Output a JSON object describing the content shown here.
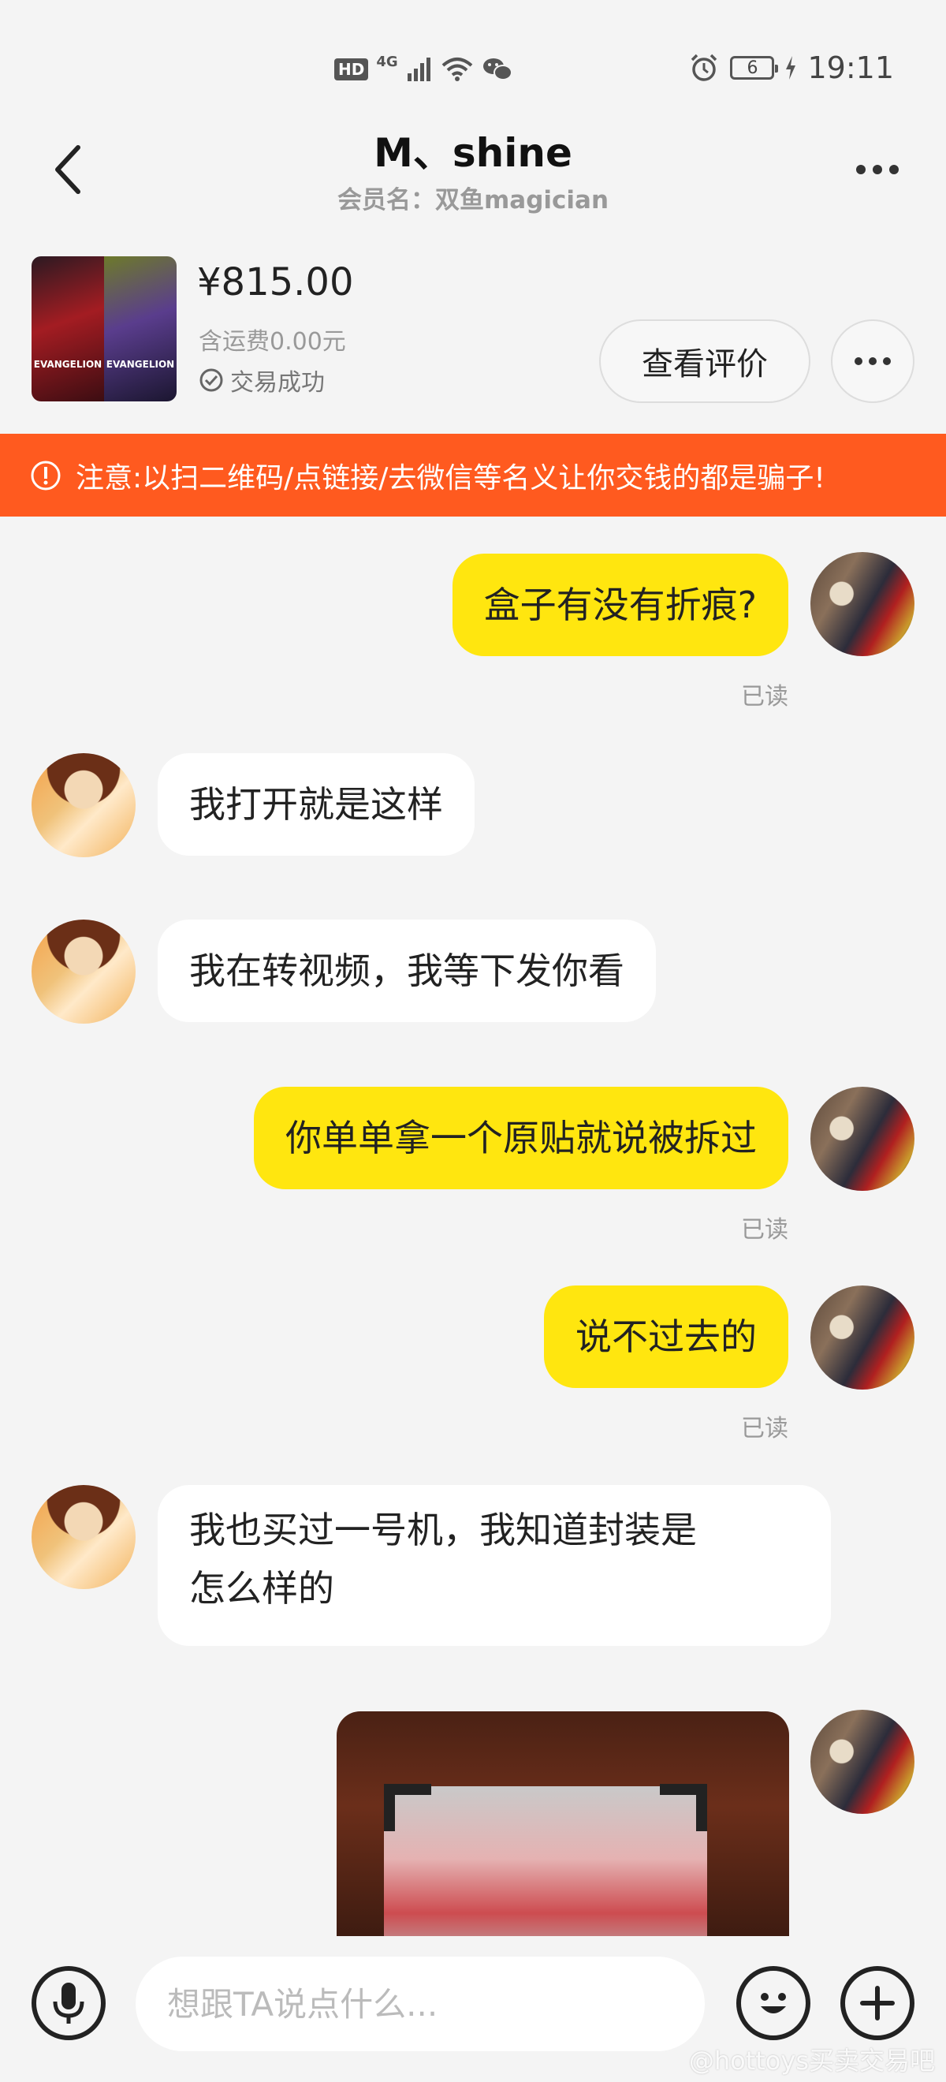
{
  "status_bar": {
    "hd": "HD",
    "network": "4G",
    "battery": "6",
    "time": "19:11"
  },
  "header": {
    "title": "M、shine",
    "subtitle": "会员名：双鱼magician"
  },
  "product": {
    "thumb_label_left": "EVANGELION",
    "thumb_label_right": "EVANGELION",
    "price": "¥815.00",
    "shipping": "含运费0.00元",
    "status": "交易成功",
    "review_button": "查看评价"
  },
  "warning": {
    "text": "注意:以扫二维码/点链接/去微信等名义让你交钱的都是骗子!"
  },
  "messages": [
    {
      "from": "me",
      "text": "盒子有没有折痕?",
      "read": "已读"
    },
    {
      "from": "peer",
      "text": "我打开就是这样"
    },
    {
      "from": "peer",
      "text": "我在转视频，我等下发你看"
    },
    {
      "from": "me",
      "text": "你单单拿一个原贴就说被拆过",
      "read": "已读"
    },
    {
      "from": "me",
      "text": "说不过去的",
      "read": "已读"
    },
    {
      "from": "peer",
      "text_line1": "我也买过一号机，我知道封装是",
      "text_line2": "怎么样的"
    }
  ],
  "input": {
    "placeholder": "想跟TA说点什么..."
  },
  "watermark": "@hottoys买卖交易吧",
  "colors": {
    "accent_yellow": "#ffe60f",
    "warning_orange": "#ff5a1f",
    "background": "#f4f4f4"
  }
}
